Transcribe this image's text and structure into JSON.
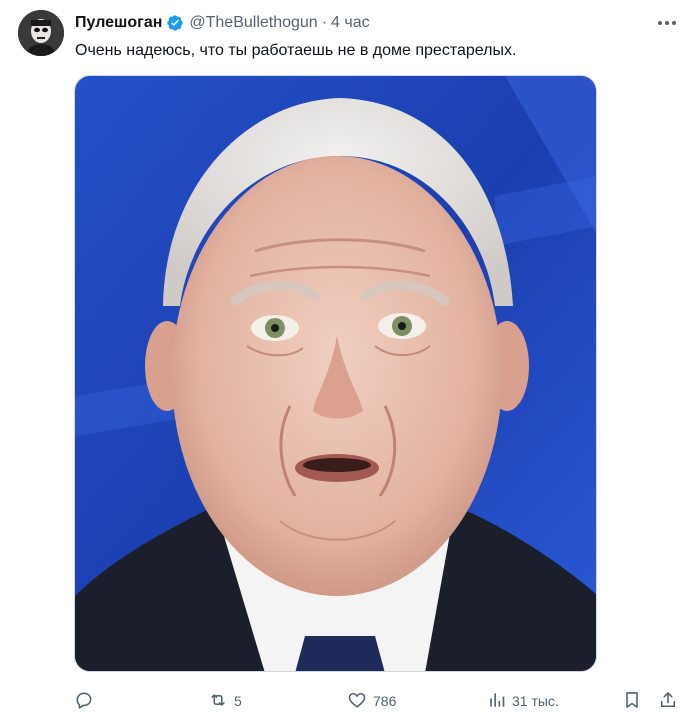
{
  "tweet": {
    "author_name": "Пулешоган",
    "handle": "@TheBullethogun",
    "separator": "·",
    "time": "4 час",
    "text": "Очень надеюсь, что ты работаешь не в доме престарелых."
  },
  "actions": {
    "reply_count": "",
    "retweet_count": "5",
    "like_count": "786",
    "views_count": "31 тыс."
  },
  "icons": {
    "verified": "verified-badge-icon",
    "more": "more-dots-icon",
    "reply": "reply-icon",
    "retweet": "retweet-icon",
    "like": "heart-icon",
    "views": "views-chart-icon",
    "bookmark": "bookmark-icon",
    "share": "share-icon"
  },
  "colors": {
    "text_primary": "#0f1419",
    "text_secondary": "#536471",
    "verified_blue": "#1d9bf0",
    "media_background_blue": "#1f45b8"
  }
}
